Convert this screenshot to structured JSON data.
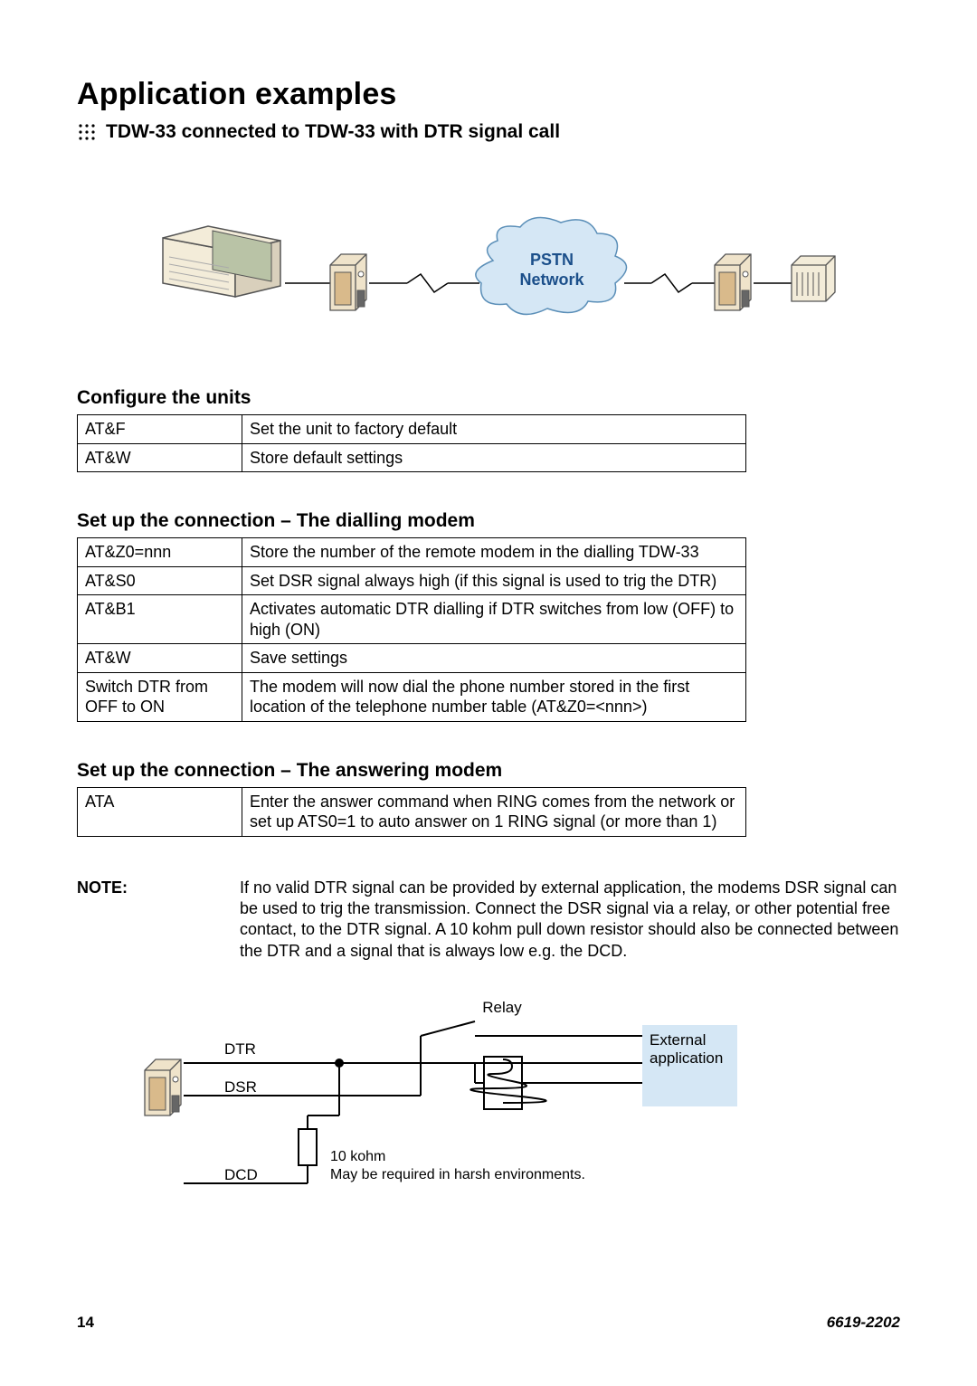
{
  "title": "Application examples",
  "subtitle": "TDW-33 connected to TDW-33 with DTR signal call",
  "diagram1": {
    "cloud_line1": "PSTN",
    "cloud_line2": "Network"
  },
  "section_configure": "Configure the units",
  "table_configure": [
    {
      "cmd": "AT&F",
      "desc": "Set the unit to factory default"
    },
    {
      "cmd": "AT&W",
      "desc": "Store default settings"
    }
  ],
  "section_dialling": "Set up the connection – The dialling modem",
  "table_dialling": [
    {
      "cmd": "AT&Z0=nnn",
      "desc": "Store the number of the remote modem in the dialling TDW-33"
    },
    {
      "cmd": "AT&S0",
      "desc": "Set DSR signal always high (if this signal is used to trig the DTR)"
    },
    {
      "cmd": "AT&B1",
      "desc": "Activates automatic DTR dialling if DTR switches from low (OFF) to high (ON)"
    },
    {
      "cmd": "AT&W",
      "desc": "Save settings"
    },
    {
      "cmd": "Switch DTR from OFF to ON",
      "desc": "The modem will now dial the phone number stored in the first location of the telephone number table (AT&Z0=<nnn>)"
    }
  ],
  "section_answering": "Set up the connection – The answering modem",
  "table_answering": [
    {
      "cmd": "ATA",
      "desc": "Enter the answer command when RING comes from the network or set up ATS0=1 to auto answer on 1 RING signal (or more than 1)"
    }
  ],
  "note_label": "NOTE:",
  "note_body": "If no valid DTR signal can be provided by external application, the modems DSR signal can be used to trig the transmission. Connect the DSR signal via a relay, or other potential free contact, to the DTR signal. A 10 kohm pull down resistor should also be connected between the DTR and a signal that is always low e.g. the DCD.",
  "diagram2": {
    "dtr": "DTR",
    "dsr": "DSR",
    "dcd": "DCD",
    "relay": "Relay",
    "ext1": "External",
    "ext2": "application",
    "res": "10 kohm",
    "res_note": "May be required in harsh environments."
  },
  "page_number": "14",
  "doc_number": "6619-2202"
}
